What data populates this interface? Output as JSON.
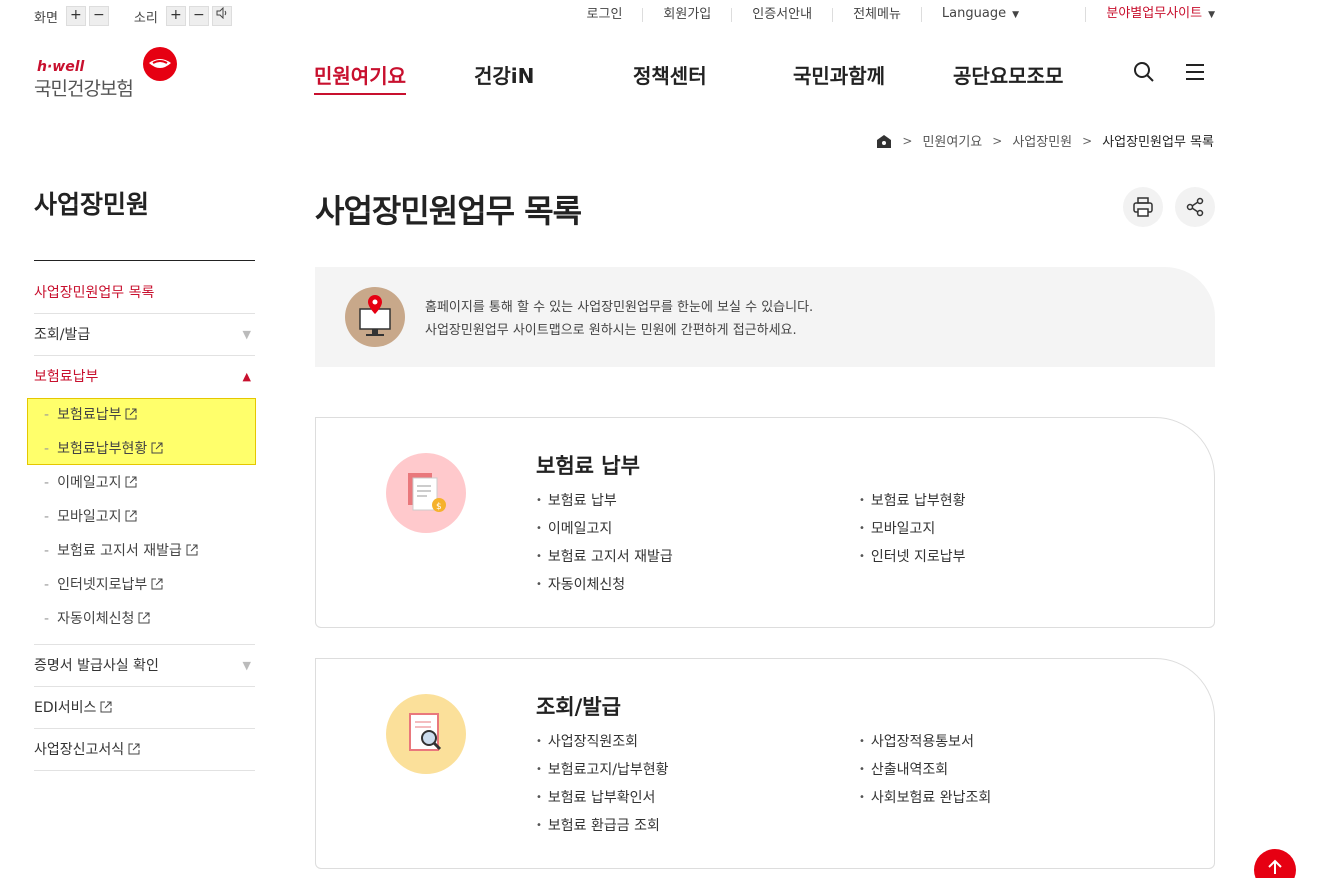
{
  "util": {
    "screen_label": "화면",
    "sound_label": "소리",
    "plus": "+",
    "minus": "−",
    "links": [
      "로그인",
      "회원가입",
      "인증서안내",
      "전체메뉴"
    ],
    "language": "Language",
    "site": "분야별업무사이트"
  },
  "logo": {
    "brand": "h·well",
    "name": "국민건강보험"
  },
  "gnb": [
    "민원여기요",
    "건강iN",
    "정책센터",
    "국민과함께",
    "공단요모조모"
  ],
  "breadcrumb": [
    "민원여기요",
    "사업장민원",
    "사업장민원업무 목록"
  ],
  "sidebar": {
    "title": "사업장민원",
    "items": [
      "사업장민원업무 목록",
      "조회/발급",
      "보험료납부",
      "증명서 발급사실 확인",
      "EDI서비스",
      "사업장신고서식"
    ],
    "sub": [
      "보험료납부",
      "보험료납부현황",
      "이메일고지",
      "모바일고지",
      "보험료 고지서 재발급",
      "인터넷지로납부",
      "자동이체신청"
    ]
  },
  "page": {
    "title": "사업장민원업무 목록",
    "intro_line1": "홈페이지를 통해 할 수 있는 사업장민원업무를 한눈에 보실 수 있습니다.",
    "intro_line2": "사업장민원업무 사이트맵으로 원하시는 민원에 간편하게 접근하세요."
  },
  "cards": [
    {
      "title": "보험료 납부",
      "left": [
        "보험료 납부",
        "이메일고지",
        "보험료 고지서 재발급",
        "자동이체신청"
      ],
      "right": [
        "보험료 납부현황",
        "모바일고지",
        "인터넷 지로납부"
      ]
    },
    {
      "title": "조회/발급",
      "left": [
        "사업장직원조회",
        "보험료고지/납부현황",
        "보험료 납부확인서",
        "보험료 환급금 조회"
      ],
      "right": [
        "사업장적용통보서",
        "산출내역조회",
        "사회보험료 완납조회"
      ]
    }
  ],
  "colors": {
    "accent": "#c8102e",
    "highlight": "#ffff6b",
    "card1_icon_bg": "#ffc9cc",
    "card2_icon_bg": "#fbe09a"
  }
}
